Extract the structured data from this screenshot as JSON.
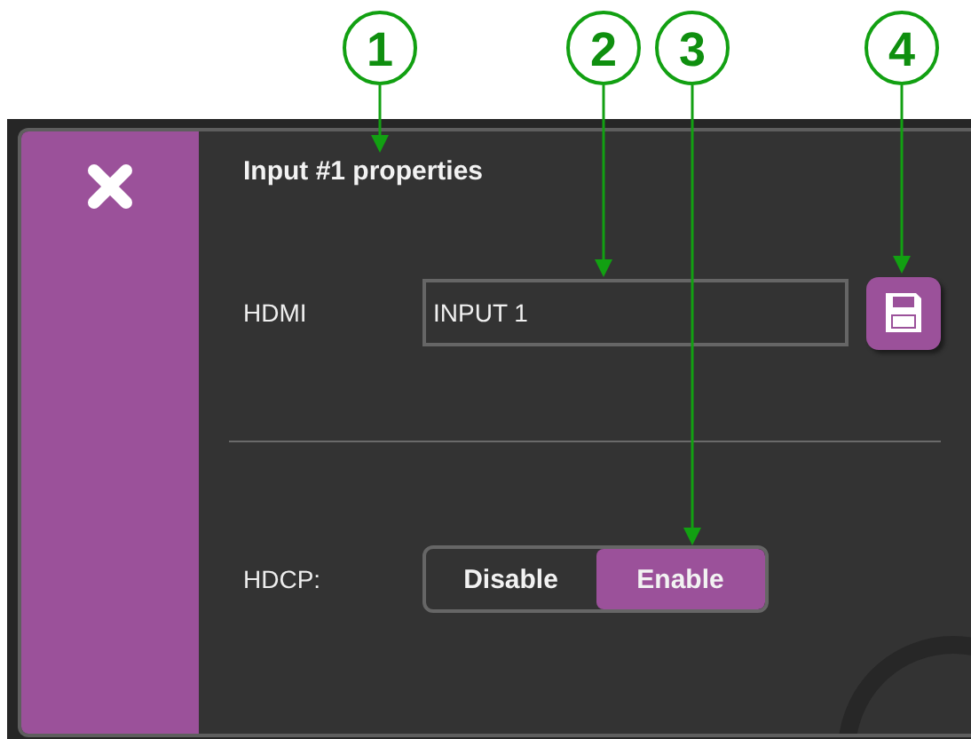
{
  "callouts": [
    {
      "number": "1"
    },
    {
      "number": "2"
    },
    {
      "number": "3"
    },
    {
      "number": "4"
    }
  ],
  "panel": {
    "title": "Input #1 properties",
    "name_row": {
      "label": "HDMI",
      "value": "INPUT 1"
    },
    "hdcp": {
      "label": "HDCP:",
      "options": [
        {
          "label": "Disable",
          "selected": false
        },
        {
          "label": "Enable",
          "selected": true
        }
      ]
    }
  }
}
